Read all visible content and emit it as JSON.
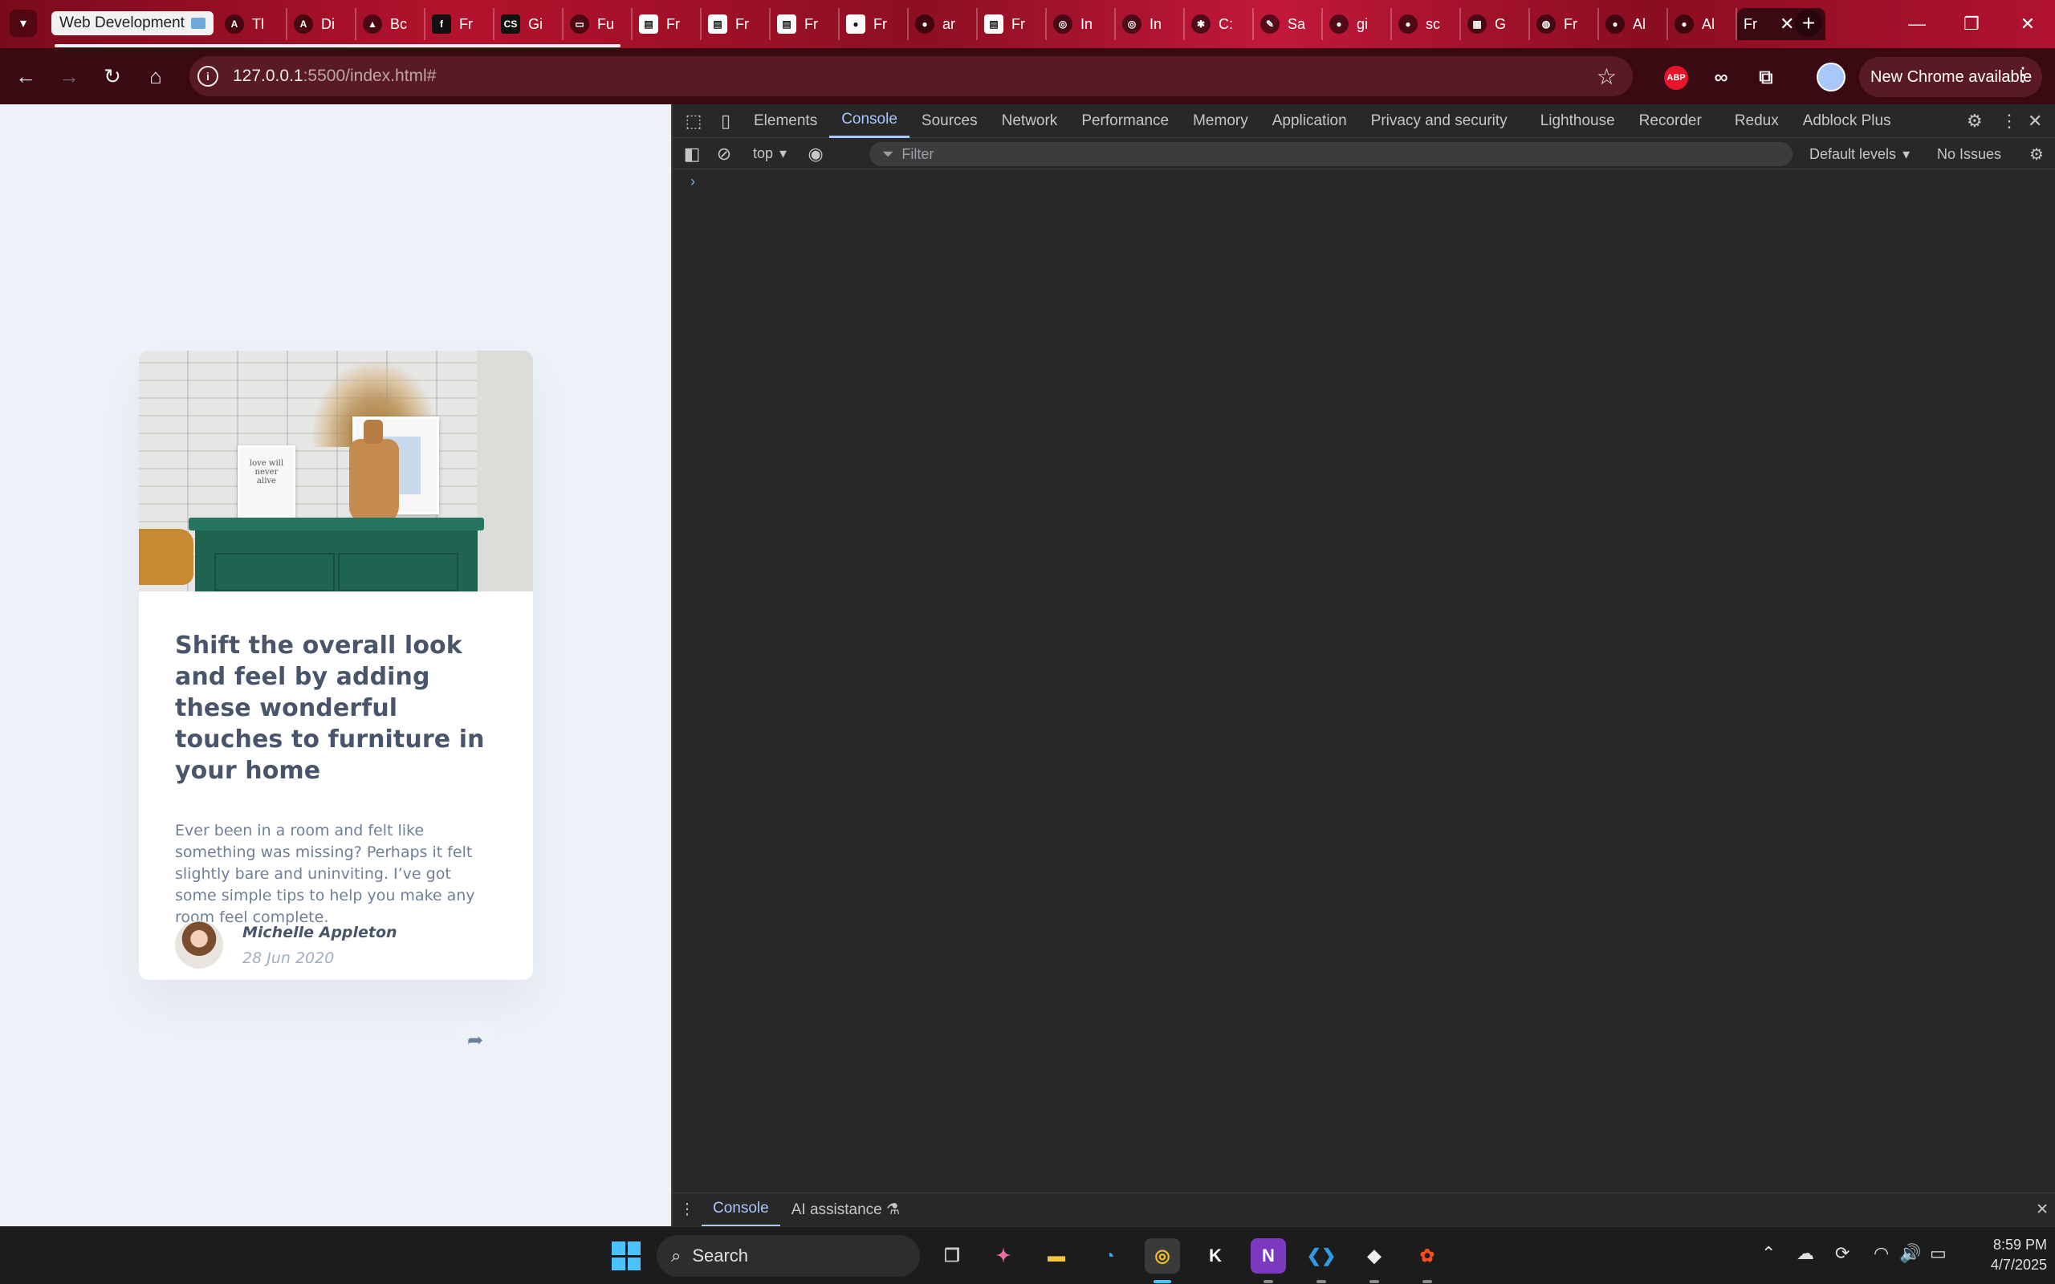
{
  "browser": {
    "tab_group_label": "Web Development",
    "tabs": [
      {
        "label": "Tl",
        "icon": "angular-icon"
      },
      {
        "label": "Di",
        "icon": "angular-icon"
      },
      {
        "label": "Bc",
        "icon": "triangle-icon"
      },
      {
        "label": "Fr",
        "icon": "frontend-mentor-icon"
      },
      {
        "label": "Gi",
        "icon": "css-icon"
      },
      {
        "label": "Fu",
        "icon": "tv-icon"
      },
      {
        "label": "Fr",
        "icon": "document-icon"
      },
      {
        "label": "Fr",
        "icon": "document-icon"
      },
      {
        "label": "Fr",
        "icon": "document-icon"
      },
      {
        "label": "Fr",
        "icon": "circle-icon"
      },
      {
        "label": "ar",
        "icon": "github-icon"
      },
      {
        "label": "Fr",
        "icon": "document-icon"
      },
      {
        "label": "In",
        "icon": "chrome-icon"
      },
      {
        "label": "In",
        "icon": "chrome-icon"
      },
      {
        "label": "C:",
        "icon": "asterisk-icon"
      },
      {
        "label": "Sa",
        "icon": "brush-icon"
      },
      {
        "label": "gi",
        "icon": "github-icon"
      },
      {
        "label": "sc",
        "icon": "github-icon"
      },
      {
        "label": "G",
        "icon": "grid-icon"
      },
      {
        "label": "Fr",
        "icon": "globe-icon"
      },
      {
        "label": "Al",
        "icon": "github-icon"
      },
      {
        "label": "Al",
        "icon": "github-icon"
      }
    ],
    "active_tab_label": "Fr",
    "new_tab_symbol": "+",
    "url_host": "127.0.0.1",
    "url_rest": ":5500/index.html#",
    "abp_label": "ABP",
    "update_label": "New Chrome available"
  },
  "card": {
    "title": "Shift the overall look and feel by adding these wonderful touches to furniture in your home",
    "description": "Ever been in a room and felt like something was missing? Perhaps it felt slightly bare and uninviting. I’ve got some simple tips to help you make any room feel complete.",
    "author_name": "Michelle Appleton",
    "date": "28 Jun 2020",
    "frame_text": "love will never alive"
  },
  "devtools": {
    "tabs": [
      "Elements",
      "Console",
      "Sources",
      "Network",
      "Performance",
      "Memory",
      "Application",
      "Privacy and security",
      "Lighthouse",
      "Recorder",
      "Redux",
      "Adblock Plus"
    ],
    "active_tab": "Console",
    "context": "top",
    "filter_placeholder": "Filter",
    "levels": "Default levels",
    "issues": "No Issues",
    "prompt": "›",
    "drawer_tabs": [
      "Console",
      "AI assistance"
    ]
  },
  "taskbar": {
    "search_label": "Search",
    "time": "8:59 PM",
    "date": "4/7/2025"
  },
  "colors": {
    "page_bg": "#ecf2f8",
    "title": "#48556a",
    "body_text": "#6e8098",
    "muted": "#9eafc2",
    "devtools_accent": "#a8c7fa"
  }
}
